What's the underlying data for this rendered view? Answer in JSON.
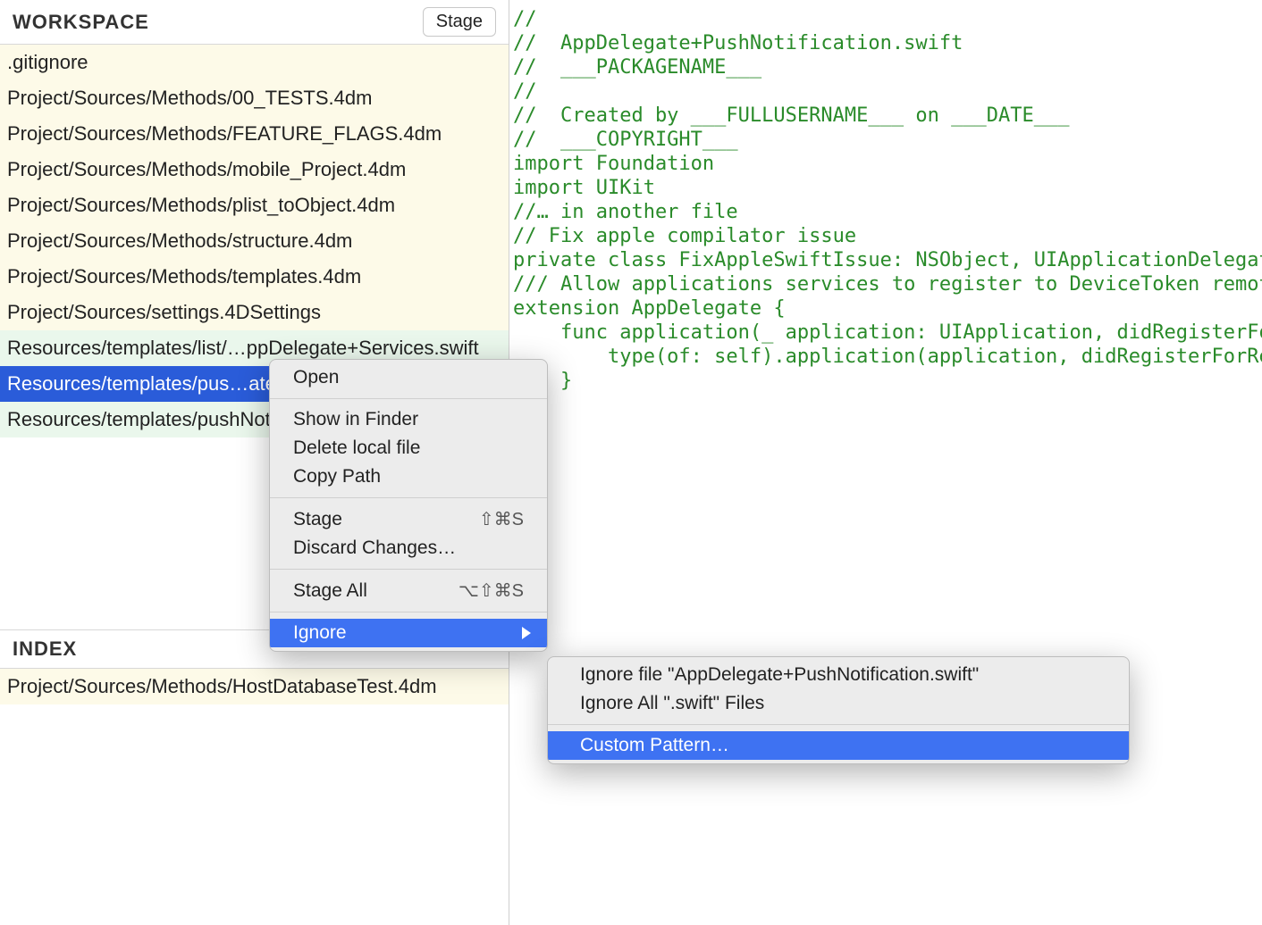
{
  "workspace": {
    "title": "WORKSPACE",
    "stageButton": "Stage",
    "files": [
      ".gitignore",
      "Project/Sources/Methods/00_TESTS.4dm",
      "Project/Sources/Methods/FEATURE_FLAGS.4dm",
      "Project/Sources/Methods/mobile_Project.4dm",
      "Project/Sources/Methods/plist_toObject.4dm",
      "Project/Sources/Methods/structure.4dm",
      "Project/Sources/Methods/templates.4dm",
      "Project/Sources/settings.4DSettings",
      "Resources/templates/list/…ppDelegate+Services.swift",
      "Resources/templates/pus…ate+PushNotification.swift",
      "Resources/templates/pushNotification/storyboard"
    ]
  },
  "index": {
    "title": "INDEX",
    "files": [
      "Project/Sources/Methods/HostDatabaseTest.4dm"
    ]
  },
  "code": [
    "//",
    "//  AppDelegate+PushNotification.swift",
    "//  ___PACKAGENAME___",
    "//",
    "//  Created by ___FULLUSERNAME___ on ___DATE___",
    "//  ___COPYRIGHT___",
    "",
    "import Foundation",
    "import UIKit",
    "",
    "//… in another file",
    "",
    "// Fix apple compilator issue",
    "private class FixAppleSwiftIssue: NSObject, UIApplicationDelegate {}",
    "",
    "/// Allow applications services to register to DeviceToken remote notif",
    "extension AppDelegate {",
    "",
    "    func application(_ application: UIApplication, didRegisterForRemot",
    "        type(of: self).application(application, didRegisterForRemoteNo",
    "    }"
  ],
  "menu": {
    "open": "Open",
    "showFinder": "Show in Finder",
    "deleteLocal": "Delete local file",
    "copyPath": "Copy Path",
    "stage": "Stage",
    "stageShortcut": "⇧⌘S",
    "discard": "Discard Changes…",
    "stageAll": "Stage All",
    "stageAllShortcut": "⌥⇧⌘S",
    "ignore": "Ignore"
  },
  "submenu": {
    "ignoreFile": "Ignore file \"AppDelegate+PushNotification.swift\"",
    "ignoreAll": "Ignore All \".swift\" Files",
    "custom": "Custom Pattern…"
  }
}
